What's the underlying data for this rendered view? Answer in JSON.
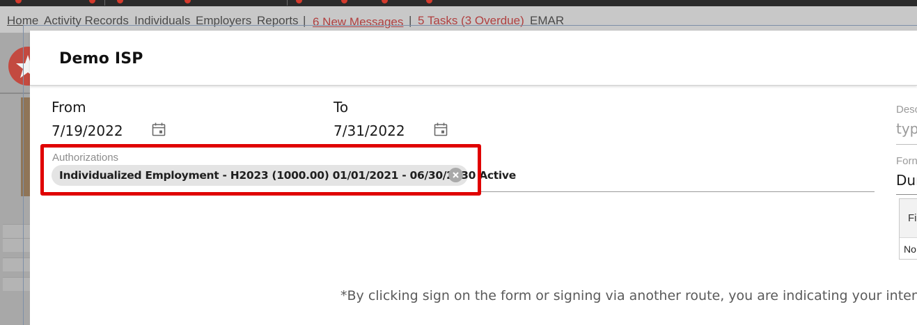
{
  "top_nav": {
    "links": [
      "Home",
      "Activity Records",
      "Individuals",
      "Employers",
      "Reports"
    ],
    "separator": "|",
    "messages": "6 New Messages",
    "tasks": "5 Tasks (3 Overdue)",
    "emar": "EMAR"
  },
  "modal": {
    "title": "Demo ISP",
    "from_label": "From",
    "from_value": "7/19/2022",
    "to_label": "To",
    "to_value": "7/31/2022",
    "authorizations_label": "Authorizations",
    "authorization_chip": "Individualized Employment - H2023 (1000.00) 01/01/2021 - 06/30/2030 Active",
    "description_label": "Desc",
    "description_placeholder": "typ",
    "form_label": "Forn",
    "form_value": "Dur",
    "table_header": "Fi",
    "table_cell": "No",
    "sign_notice": "*By clicking sign on the form or signing via another route, you are indicating your intent to"
  },
  "icons": {
    "calendar": "calendar-icon",
    "chip_remove": "close-circle-icon",
    "logo": "star-logo-icon"
  },
  "colors": {
    "highlight_border": "#e00000",
    "nav_alert": "#b04040",
    "chip_bg": "#e4e4e4"
  }
}
